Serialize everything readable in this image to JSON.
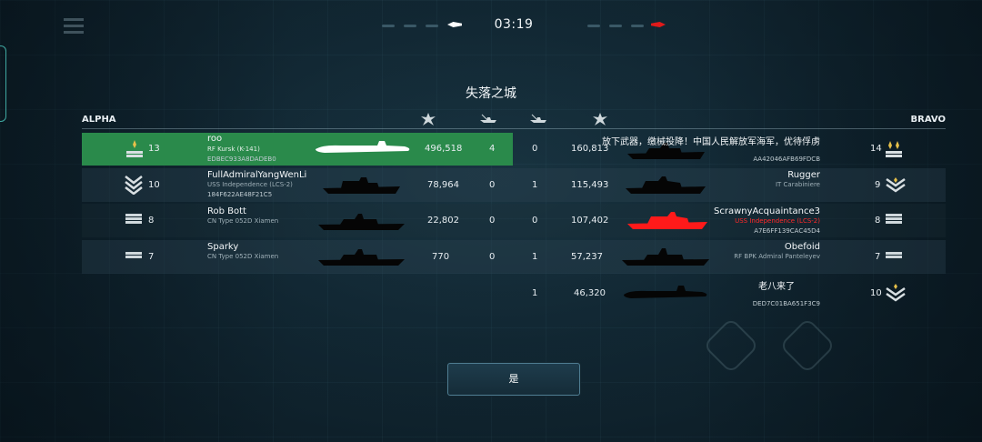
{
  "map_title": "失落之城",
  "timer": "03:19",
  "teams": {
    "left_name": "ALPHA",
    "right_name": "BRAVO"
  },
  "colors": {
    "highlight_row": "#2a8a4b",
    "enemy_highlight": "#ff2a2a",
    "accent_teal": "#3fa7a0"
  },
  "header_icons": [
    "damage-icon",
    "kills-ship-icon",
    "kills-ship-icon",
    "damage-icon"
  ],
  "alpha": [
    {
      "rank": "13",
      "name": "roo",
      "ship": "RF Kursk (K-141)",
      "uid": "EDBEC933A8DADEB0",
      "damage": "496,518",
      "kills": "4",
      "highlighted": true
    },
    {
      "rank": "10",
      "name": "FullAdmiralYangWenLi",
      "ship": "USS Independence (LCS-2)",
      "uid": "184F622AE48F21C5",
      "damage": "78,964",
      "kills": "0"
    },
    {
      "rank": "8",
      "name": "Rob Bott",
      "ship": "CN Type 052D Xiamen",
      "uid": "",
      "damage": "22,802",
      "kills": "0"
    },
    {
      "rank": "7",
      "name": "Sparky",
      "ship": "CN Type 052D Xiamen",
      "uid": "",
      "damage": "770",
      "kills": "0"
    }
  ],
  "bravo": [
    {
      "kills": "0",
      "damage": "160,813",
      "name": "放下武器，缴械投降！中国人民解放军海军，优待俘虏",
      "ship": "",
      "uid": "AA42046AFB69FDCB",
      "rank": "14"
    },
    {
      "kills": "1",
      "damage": "115,493",
      "name": "Rugger",
      "ship": "IT Carabiniere",
      "uid": "",
      "rank": "9"
    },
    {
      "kills": "0",
      "damage": "107,402",
      "name": "ScrawnyAcquaintance3",
      "ship": "USS Independence (LCS-2)",
      "uid": "A7E6FF139CAC45D4",
      "rank": "8",
      "enemy_highlight": true
    },
    {
      "kills": "1",
      "damage": "57,237",
      "name": "Obefoid",
      "ship": "RF BPK Admiral Panteleyev",
      "uid": "",
      "rank": "7"
    },
    {
      "kills": "1",
      "damage": "46,320",
      "name": "老八来了",
      "ship": "",
      "uid": "DED7C01BA651F3C9",
      "rank": "10"
    }
  ],
  "confirm_button": "是"
}
